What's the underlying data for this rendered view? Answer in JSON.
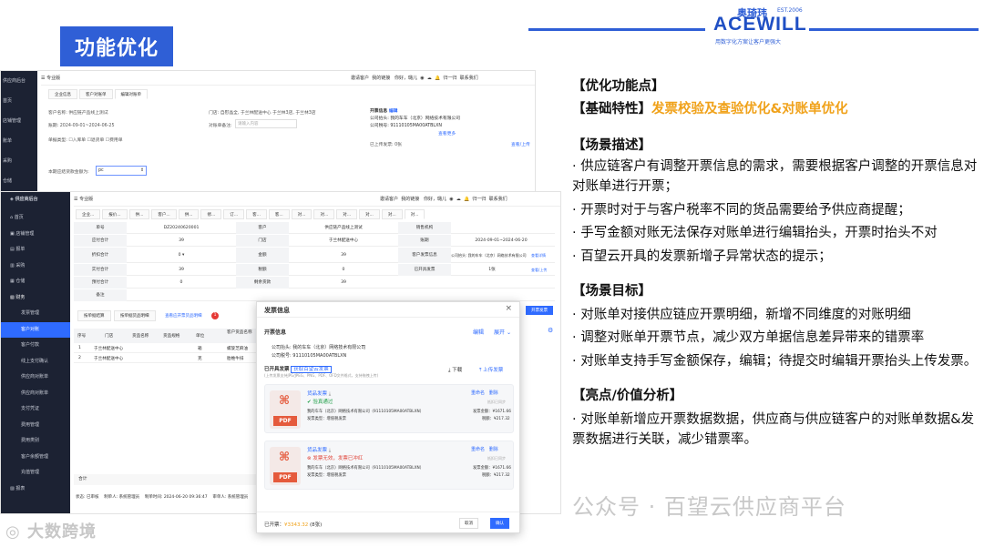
{
  "slide_title": "功能优化",
  "logo": {
    "cn": "奥琦玮",
    "est": "EST.2006",
    "en": "ACEWILL",
    "tagline": "用数字化方案让客户更强大"
  },
  "description": {
    "sec1": "【优化功能点】",
    "sec2_prefix": "【基础特性】",
    "sec2_highlight": "发票校验及查验优化&对账单优化",
    "sec3": "【场景描述】",
    "scene_items": [
      "· 供应链客户有调整开票信息的需求，需要根据客户调整的开票信息对对账单进行开票；",
      "·  开票时对于与客户税率不同的货品需要给予供应商提醒；",
      "·  手写金额对账无法保存对账单进行编辑抬头，开票时抬头不对",
      "·  百望云开具的发票新增子异常状态的提示；"
    ],
    "sec4": "【场景目标】",
    "goal_items": [
      "·  对账单对接供应链应开票明细，新增不同维度的对账明细",
      "·  调整对账单开票节点，减少双方单据信息差异带来的错票率",
      "·  对账单支持手写金额保存，编辑；待提交时编辑开票抬头上传发票。"
    ],
    "sec5": "【亮点/价值分析】",
    "value_items": [
      "·   对账单新增应开票数据数据，供应商与供应链客户的对账单数据&发票数据进行关联，减少错票率。"
    ]
  },
  "screen1": {
    "sidebar": [
      "供应商后台",
      "首页",
      "店铺管理",
      "账单",
      "采购",
      "仓储"
    ],
    "edition": "专业版",
    "header_right": [
      "邀请客户",
      "我的链接",
      "你好，璐儿",
      "归一归",
      "联系我们"
    ],
    "tabs": [
      "企业信息",
      "客户对账单",
      "编辑对账单"
    ],
    "customer_label": "客户名称: 供应链产品线上测试",
    "store_label": "门店: 自慰晶全, 于兰林配送中心 于兰林3店, 于兰林3店",
    "date_label": "账期: 2024-09-01~2024-06-25",
    "remark_label": "对账单备注:",
    "remark_placeholder": "请输入内容",
    "invoice_info": "开票信息",
    "invoice_edit": "编辑",
    "company_title": "公司抬头: 我的车车（北京）网络技术有限公司",
    "tax_no": "公司税号: 91110105MA00ATBLXN",
    "view_more": "查看更多",
    "doc_type_label": "单据类型:",
    "doc_types": [
      "入库单",
      "退货单",
      "费用单"
    ],
    "uploaded_label": "已上传发票:",
    "uploaded_count": "0张",
    "view_upload": "查看/上传",
    "amount_label": "本期应结货款金额为:",
    "amount_value": "pc"
  },
  "screen2": {
    "sidebar": [
      "供应商后台",
      "首页",
      "店铺管理",
      "报单",
      "采购",
      "仓储",
      "财务",
      "发票管理",
      "客户对账",
      "客户付款",
      "线上支付确认",
      "供应商对账单",
      "供应商对账单",
      "支付凭证",
      "费用管理",
      "费用类别",
      "客户余额管理",
      "充值管理",
      "报表"
    ],
    "edition": "专业版",
    "header_right": [
      "邀请客户",
      "我的链接",
      "你好，璐儿",
      "归一归",
      "联系我们"
    ],
    "tabs": [
      "企业...",
      "报价...",
      "供...",
      "客户...",
      "供...",
      "修...",
      "订...",
      "客...",
      "客...",
      "对...",
      "对...",
      "对...",
      "对...",
      "对...",
      "对..."
    ],
    "detail_rows": [
      [
        "单号",
        "DZ20240620001",
        "客户",
        "供应链产品线上测试",
        "销售机构",
        ""
      ],
      [
        "应付合计",
        "39",
        "门店",
        "于兰林配送中心",
        "账期",
        "2024-09-01~2024-06-20"
      ],
      [
        "折扣合计",
        "0",
        "金额",
        "39",
        "客户发票信息",
        "公司抬头: 我的车车（北京）网络技术有限公司"
      ],
      [
        "实付合计",
        "39",
        "税额",
        "0",
        "已开具发票",
        "1张"
      ],
      [
        "预付合计",
        "0",
        "剩余货款",
        "39",
        "",
        ""
      ],
      [
        "备注",
        "",
        "",
        "",
        "",
        ""
      ]
    ],
    "invoice_detail_more": "查看详情",
    "view_upload": "查看/上传",
    "sub_tabs": [
      "按单据结算",
      "按单据货品明细",
      "查看应开票货品明细"
    ],
    "sub_tab_badge": "1",
    "table_headers": [
      "序号",
      "门店",
      "货品名称",
      "货品规格",
      "单位",
      "客户货品名称"
    ],
    "table_rows": [
      [
        "1",
        "于兰林配送中心",
        "",
        "",
        "箱",
        "螺旋芝麻油"
      ],
      [
        "2",
        "于兰林配送中心",
        "",
        "",
        "克",
        "胎椎牛排"
      ]
    ],
    "total_label": "合计",
    "footer": [
      "状态: 已审核",
      "制单人: 系统管理员",
      "制单时间: 2024-06-20 09:36:47",
      "审单人: 系统管理员"
    ],
    "open_invoice_btn": "开票发票"
  },
  "modal": {
    "title": "发票信息",
    "invoice_info": "开票信息",
    "edit": "编辑",
    "expand": "展开",
    "company_title": "公司抬头: 我的车车（北京）网络技术有限公司",
    "tax_no": "公司税号: 91110105MA00ATBLXN",
    "issued_label": "已开具发票",
    "get_baiwang": "获取百望云发票",
    "upload_hint": "(上传发票支持JPG/JPEG、PNG、PDF、OFD文件格式，支持拖拽上传)",
    "download": "下载",
    "upload": "上传发票",
    "cards": [
      {
        "name": "货品发票",
        "status": "验真通过",
        "status_type": "ok",
        "rename": "重命名",
        "delete": "删除",
        "right_status": "抵扣已同步",
        "seller": "我的车车（北京）网络技术有限公司（91110105MA00ATBLXN）",
        "type": "发票类型：增值税发票",
        "amount": "发票金额：¥1671.66",
        "tax": "税额：¥217.32"
      },
      {
        "name": "货品发票",
        "status": "发票无效，发票已冲红",
        "status_type": "err",
        "rename": "重命名",
        "delete": "删除",
        "right_status": "抵扣已同步",
        "seller": "我的车车（北京）网络技术有限公司（91110105MA00ATBLXN）",
        "type": "发票类型：增值税发票",
        "amount": "发票金额：¥1671.66",
        "tax": "税额：¥217.32"
      }
    ],
    "pdf_label": "PDF",
    "footer_issued": "已开票：",
    "footer_amount": "¥3343.32",
    "footer_count": "(8张)",
    "cancel": "取消",
    "confirm": "确认"
  },
  "watermarks": {
    "left": "大数跨境",
    "right": "公众号 · 百望云供应商平台"
  },
  "colors": {
    "brand_blue": "#2f5fd6",
    "highlight_orange": "#f0a21b",
    "sidebar_dark": "#1c2233",
    "active_blue": "#2f6bff"
  }
}
